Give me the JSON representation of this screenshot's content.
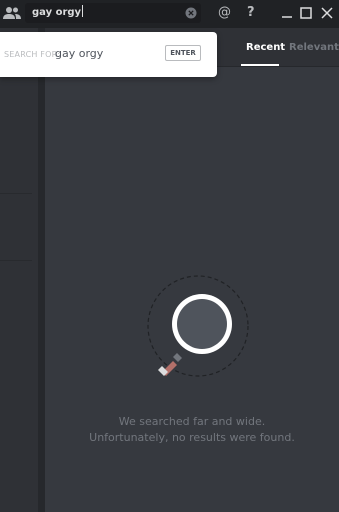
{
  "search": {
    "query": "gay orgy"
  },
  "titlebar": {
    "mention_label": "@",
    "help_label": "?"
  },
  "suggestion": {
    "label": "SEARCH FOR:",
    "query": "gay orgy",
    "enter_label": "ENTER"
  },
  "tabs": {
    "recent": "Recent",
    "relevant": "Relevant"
  },
  "empty_state": {
    "line1": "We searched far and wide.",
    "line2": "Unfortunately, no results were found."
  },
  "colors": {
    "titlebar": "#202225",
    "background": "#36393f",
    "sidebar": "#2f3136",
    "popup": "#ffffff",
    "magnifier_handle": "#b3706a"
  },
  "icons": [
    "friends-icon",
    "clear-search-icon",
    "at-icon",
    "help-icon",
    "minimize-icon",
    "maximize-icon",
    "close-icon",
    "magnifier-icon"
  ]
}
